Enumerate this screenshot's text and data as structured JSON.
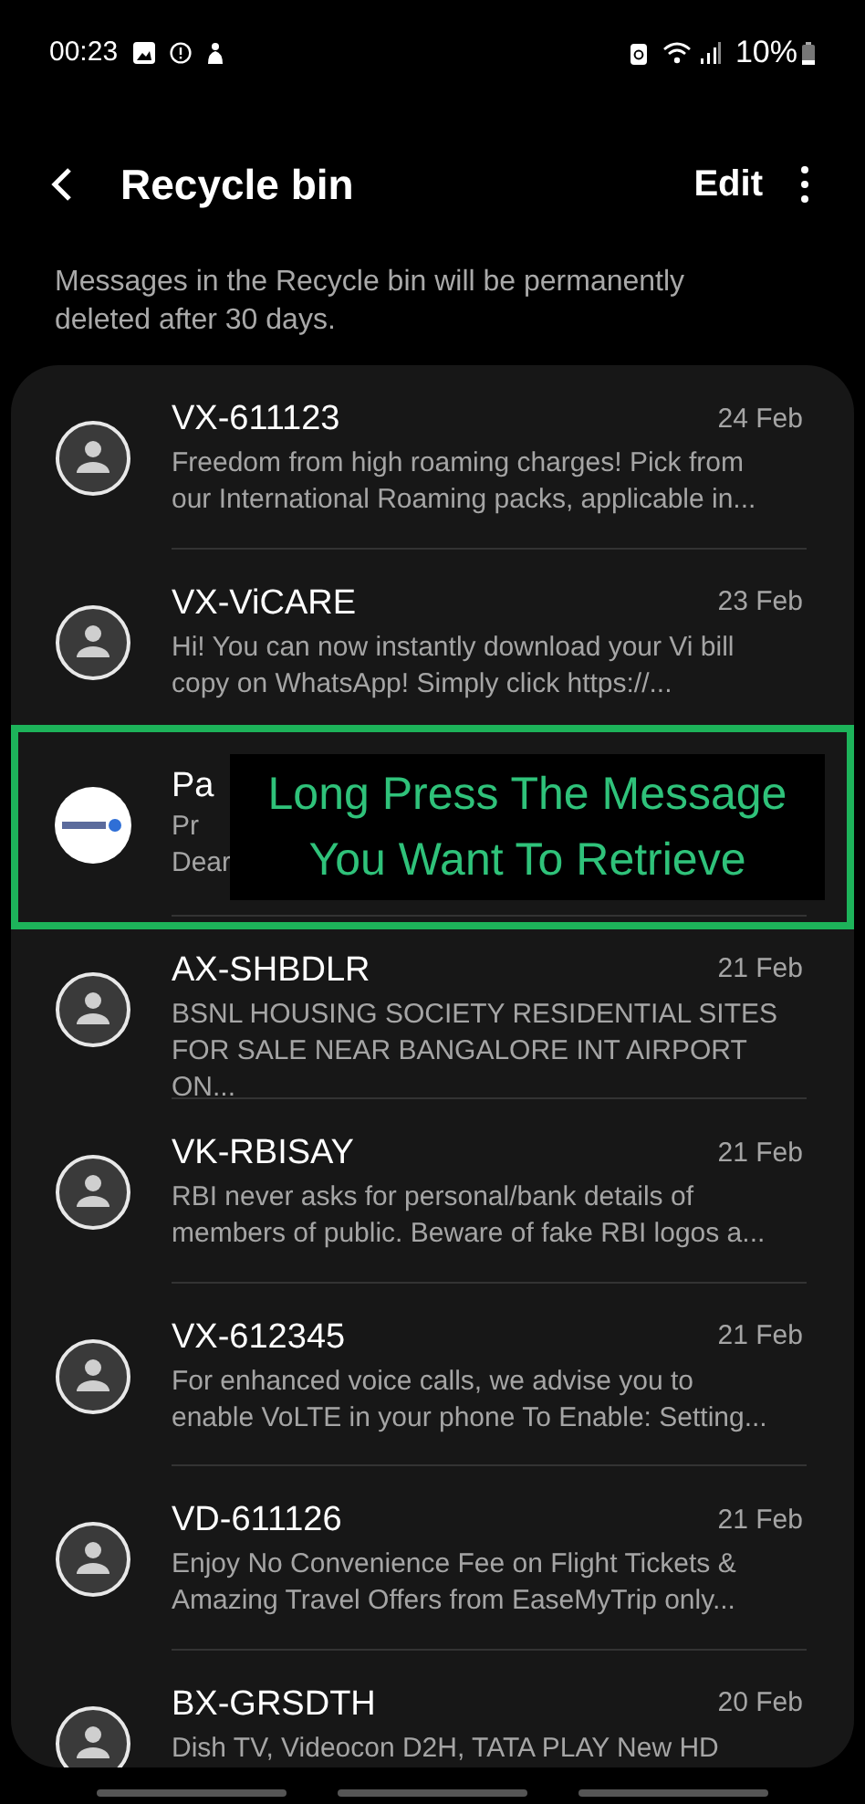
{
  "status_bar": {
    "time": "00:23",
    "battery": "10%"
  },
  "header": {
    "title": "Recycle bin",
    "action": "Edit"
  },
  "notice": "Messages in the Recycle bin will be permanently deleted after 30 days.",
  "messages": [
    {
      "sender": "VX-611123",
      "date": "24 Feb",
      "preview": "Freedom from high roaming charges! Pick from our International Roaming packs, applicable in...",
      "kind": "person"
    },
    {
      "sender": "VX-ViCARE",
      "date": "23 Feb",
      "preview": "Hi! You can now instantly download your Vi bill copy on WhatsApp! Simply click https://...",
      "kind": "person"
    },
    {
      "sender": "Pa",
      "preview_lines": [
        "Pr",
        "Dear"
      ],
      "kind": "picture"
    },
    {
      "sender": "AX-SHBDLR",
      "date": "21 Feb",
      "preview": "BSNL HOUSING SOCIETY RESIDENTIAL SITES FOR SALE NEAR BANGALORE INT AIRPORT ON...",
      "kind": "person"
    },
    {
      "sender": "VK-RBISAY",
      "date": "21 Feb",
      "preview": "RBI never asks for personal/bank details of members of public. Beware of fake RBI logos a...",
      "kind": "person"
    },
    {
      "sender": "VX-612345",
      "date": "21 Feb",
      "preview": "For enhanced voice calls, we advise you to enable VoLTE in your phone To Enable: Setting...",
      "kind": "person"
    },
    {
      "sender": "VD-611126",
      "date": "21 Feb",
      "preview": "Enjoy No Convenience Fee on Flight Tickets & Amazing Travel Offers from EaseMyTrip only...",
      "kind": "person"
    },
    {
      "sender": "BX-GRSDTH",
      "date": "20 Feb",
      "preview": "Dish TV, Videocon D2H, TATA PLAY New HD",
      "kind": "person"
    }
  ],
  "annotation": {
    "lines": [
      "Long Press The Message",
      "You Want To Retrieve"
    ]
  }
}
